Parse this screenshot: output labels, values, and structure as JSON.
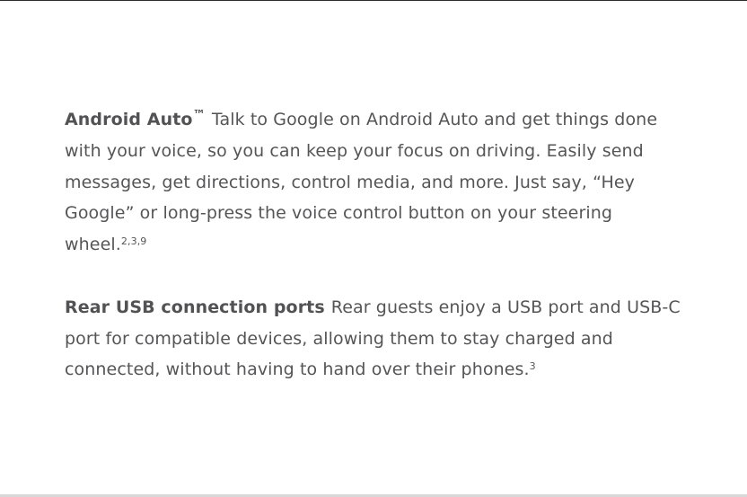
{
  "features": [
    {
      "title": "Android Auto",
      "trademark": "™",
      "body": "Talk to Google on Android Auto and get things done with your voice, so you can keep your focus on driving. Easily send messages, get directions, control media, and more. Just say, “Hey Google” or long-press the voice control button on your steering wheel.",
      "footnotes": "2,3,9"
    },
    {
      "title": "Rear USB connection ports",
      "body": "Rear guests enjoy a USB port and USB-C port for compatible devices, allowing them to stay charged and connected, without having to hand over their phones.",
      "footnotes": "3"
    }
  ]
}
